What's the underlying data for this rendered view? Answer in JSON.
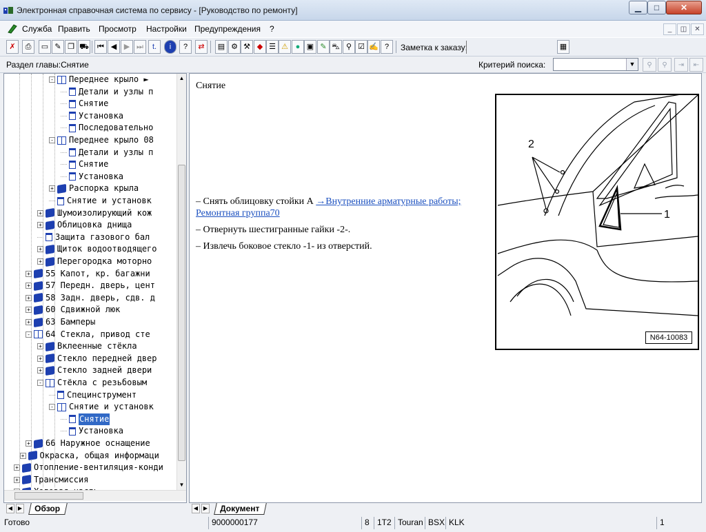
{
  "window": {
    "title": "Электронная справочная система по сервису - [Руководство по ремонту]"
  },
  "menu": [
    "Служба",
    "Править",
    "Просмотр",
    "Настройки",
    "Предупреждения",
    "?"
  ],
  "order": {
    "label": "Заметка к заказу:",
    "value": ""
  },
  "criteria": {
    "section_label": "Раздел главы:Снятие",
    "search_label": "Критерий  поиска:",
    "search_value": ""
  },
  "tree": [
    {
      "label": "Переднее крыло ►",
      "level": 3,
      "icon": "open-book",
      "expand": "-"
    },
    {
      "label": "Детали и узлы п",
      "level": 4,
      "icon": "page"
    },
    {
      "label": "Снятие",
      "level": 4,
      "icon": "page"
    },
    {
      "label": "Установка",
      "level": 4,
      "icon": "page"
    },
    {
      "label": "Последовательно",
      "level": 4,
      "icon": "page"
    },
    {
      "label": "Переднее крыло 08",
      "level": 3,
      "icon": "open-book",
      "expand": "-"
    },
    {
      "label": "Детали и узлы п",
      "level": 4,
      "icon": "page"
    },
    {
      "label": "Снятие",
      "level": 4,
      "icon": "page"
    },
    {
      "label": "Установка",
      "level": 4,
      "icon": "page"
    },
    {
      "label": "Распорка крыла",
      "level": 3,
      "icon": "book",
      "expand": "+"
    },
    {
      "label": "Снятие и установк",
      "level": 3,
      "icon": "page"
    },
    {
      "label": "Шумоизолирующий кож",
      "level": 2,
      "icon": "book",
      "expand": "+"
    },
    {
      "label": "Облицовка днища",
      "level": 2,
      "icon": "book",
      "expand": "+"
    },
    {
      "label": "Защита газового бал",
      "level": 2,
      "icon": "page"
    },
    {
      "label": "Щиток водоотводящего",
      "level": 2,
      "icon": "book",
      "expand": "+"
    },
    {
      "label": "Перегородка моторно",
      "level": 2,
      "icon": "book",
      "expand": "+"
    },
    {
      "label": "55 Капот, кр. багажни",
      "level": 1,
      "icon": "book",
      "expand": "+"
    },
    {
      "label": "57 Передн. дверь, цент",
      "level": 1,
      "icon": "book",
      "expand": "+"
    },
    {
      "label": "58 Задн. дверь, сдв. д",
      "level": 1,
      "icon": "book",
      "expand": "+"
    },
    {
      "label": "60 Сдвижной люк",
      "level": 1,
      "icon": "book",
      "expand": "+"
    },
    {
      "label": "63 Бамперы",
      "level": 1,
      "icon": "book",
      "expand": "+"
    },
    {
      "label": "64 Стекла, привод сте",
      "level": 1,
      "icon": "open-book",
      "expand": "-"
    },
    {
      "label": "Вклеенные стёкла",
      "level": 2,
      "icon": "book",
      "expand": "+"
    },
    {
      "label": "Стекло передней двер",
      "level": 2,
      "icon": "book",
      "expand": "+"
    },
    {
      "label": "Стекло задней двери",
      "level": 2,
      "icon": "book",
      "expand": "+"
    },
    {
      "label": "Стёкла с резьбовым",
      "level": 2,
      "icon": "open-book",
      "expand": "-"
    },
    {
      "label": "Специнструмент",
      "level": 3,
      "icon": "page"
    },
    {
      "label": "Снятие и установк",
      "level": 3,
      "icon": "open-book",
      "expand": "-"
    },
    {
      "label": "Снятие",
      "level": 4,
      "icon": "page",
      "selected": true
    },
    {
      "label": "Установка",
      "level": 4,
      "icon": "page"
    },
    {
      "label": "66 Наружное оснащение",
      "level": 1,
      "icon": "book",
      "expand": "+"
    },
    {
      "label": "Окраска, общая информаци",
      "level": 0.5,
      "icon": "book",
      "expand": "+"
    },
    {
      "label": "Отопление-вентиляция-конди",
      "level": 0,
      "icon": "book",
      "expand": "+"
    },
    {
      "label": "Трансмиссия",
      "level": 0,
      "icon": "book",
      "expand": "+"
    },
    {
      "label": "Ходовая часть",
      "level": 0,
      "icon": "book",
      "expand": "+"
    }
  ],
  "left_tab": "Обзор",
  "right_tab": "Документ",
  "document": {
    "title": "Снятие",
    "steps": [
      {
        "prefix": "– ",
        "text": "Снять облицовку стойки А ",
        "link": "→Внутренние арматурные работы; Ремонтная группа70"
      },
      {
        "prefix": "– ",
        "text": "Отвернуть шестигранные гайки -2-."
      },
      {
        "prefix": "– ",
        "text": "Извлечь боковое стекло -1- из отверстий."
      }
    ],
    "figure": {
      "code": "N64-10083",
      "callouts": [
        "2",
        "1"
      ]
    }
  },
  "status": {
    "text": "Готово",
    "number": "9000000177",
    "cells": [
      "8",
      "1T2",
      "Touran",
      "BSX",
      "KLK"
    ],
    "page": "1"
  },
  "colors": {
    "selection": "#3169c6",
    "link": "#1a4fbf",
    "book": "#1d3fb0"
  }
}
